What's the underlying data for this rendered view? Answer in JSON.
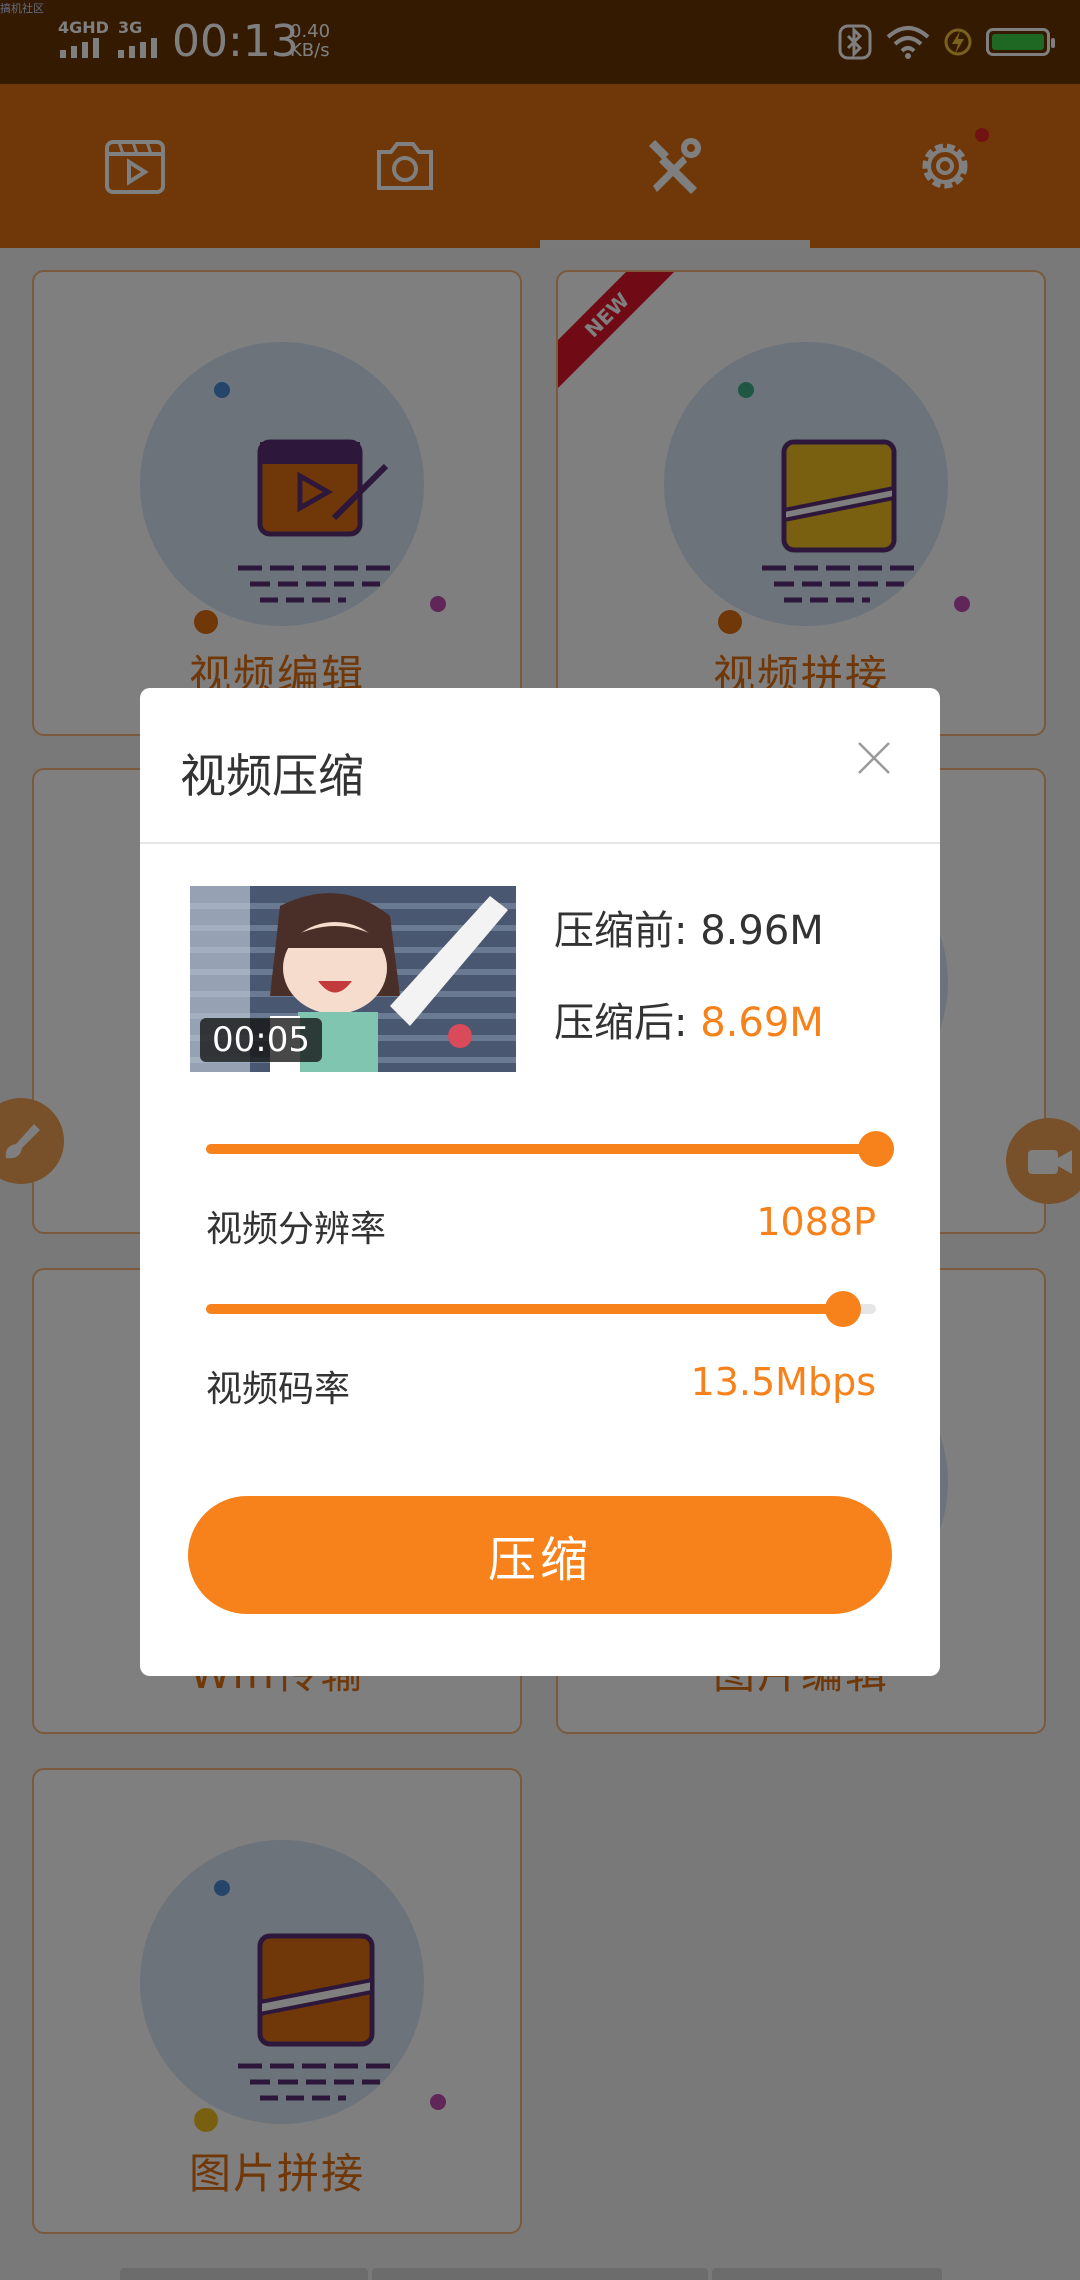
{
  "status_bar": {
    "watermark": "搞机社区",
    "net_1": "4GHD",
    "net_2": "3G",
    "time": "00:13",
    "speed_value": "0.40",
    "speed_unit": "KB/s",
    "battery_color": "#3ed046"
  },
  "top_nav": {
    "tabs": [
      {
        "icon": "video-play-icon"
      },
      {
        "icon": "camera-icon"
      },
      {
        "icon": "tools-icon",
        "active": true
      },
      {
        "icon": "gear-icon",
        "badge_dot": true
      }
    ],
    "bg_color": "#e07010"
  },
  "cards": [
    {
      "label": "视频编辑",
      "icon": "video-edit-icon"
    },
    {
      "label": "视频拼接",
      "icon": "video-join-icon",
      "badge": "NEW"
    },
    {
      "label": "",
      "icon": "hidden"
    },
    {
      "label": "",
      "icon": "hidden"
    },
    {
      "label": "Wifi传输",
      "icon": "wifi-transfer-icon"
    },
    {
      "label": "图片编辑",
      "icon": "image-edit-icon"
    },
    {
      "label": "图片拼接",
      "icon": "image-join-icon"
    }
  ],
  "dialog": {
    "title": "视频压缩",
    "thumbnail_duration": "00:05",
    "before_label": "压缩前:",
    "before_value": "8.96M",
    "after_label": "压缩后:",
    "after_value": "8.69M",
    "resolution_label": "视频分辨率",
    "resolution_value": "1088P",
    "resolution_slider_pct": 100,
    "bitrate_label": "视频码率",
    "bitrate_value": "13.5Mbps",
    "bitrate_slider_pct": 95,
    "compress_button": "压缩",
    "accent_color": "#f7821b"
  }
}
